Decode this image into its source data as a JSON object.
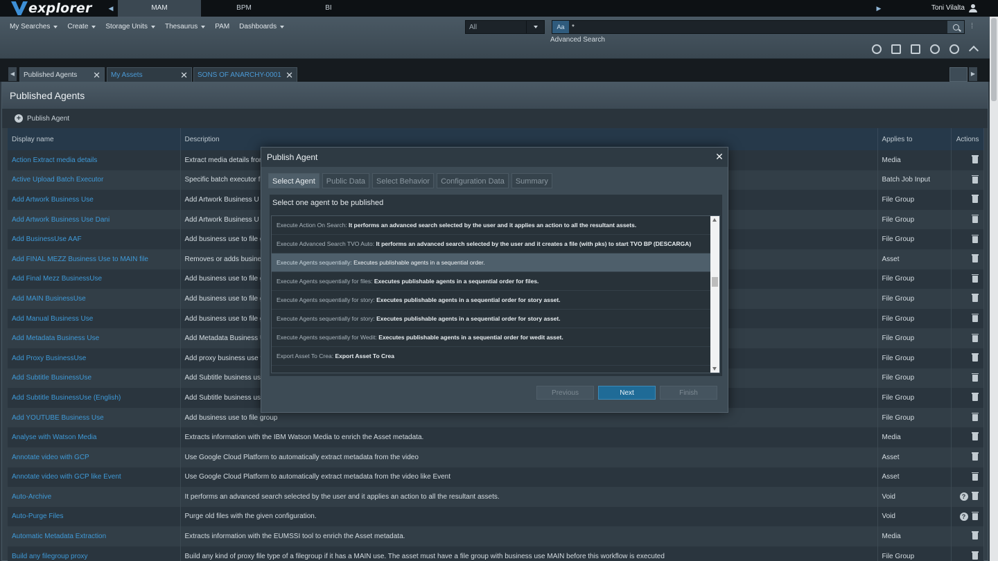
{
  "app": {
    "name": "explorer",
    "user": "Toni Vilalta"
  },
  "app_tabs": [
    {
      "label": "MAM",
      "active": true
    },
    {
      "label": "BPM",
      "active": false
    },
    {
      "label": "BI",
      "active": false
    }
  ],
  "menu": [
    "My Searches",
    "Create",
    "Storage Units",
    "Thesaurus",
    "PAM",
    "Dashboards"
  ],
  "search": {
    "scope": "All",
    "mode": "Aa",
    "query": "*",
    "advanced_label": "Advanced Search"
  },
  "doc_tabs": [
    "Published Agents",
    "My Assets",
    "SONS OF ANARCHY-0001"
  ],
  "panel": {
    "title": "Published Agents",
    "publish_label": "Publish Agent",
    "columns": {
      "name": "Display name",
      "description": "Description",
      "applies": "Applies to",
      "actions": "Actions"
    }
  },
  "rows": [
    {
      "name": "Action Extract media details",
      "desc": "Extract media details fror",
      "applies": "Media"
    },
    {
      "name": "Active Upload Batch Executor",
      "desc": "Specific batch executor fo",
      "applies": "Batch Job Input"
    },
    {
      "name": "Add Artwork Business Use",
      "desc": "Add Artwork Business U",
      "applies": "File Group"
    },
    {
      "name": "Add Artwork Business Use Dani",
      "desc": "Add Artwork Business U",
      "applies": "File Group"
    },
    {
      "name": "Add BusinessUse AAF",
      "desc": "Add business use to file g",
      "applies": "File Group"
    },
    {
      "name": "Add FINAL MEZZ Business Use to MAIN file",
      "desc": "Removes or adds busines",
      "applies": "Asset"
    },
    {
      "name": "Add Final Mezz BusinessUse",
      "desc": "Add business use to file g",
      "applies": "File Group"
    },
    {
      "name": "Add MAIN BusinessUse",
      "desc": "Add business use to file g",
      "applies": "File Group"
    },
    {
      "name": "Add Manual Business Use",
      "desc": "Add business use to file g",
      "applies": "File Group"
    },
    {
      "name": "Add Metadata Business Use",
      "desc": "Add Metadata Business U",
      "applies": "File Group"
    },
    {
      "name": "Add Proxy BusinessUse",
      "desc": "Add proxy business use t",
      "applies": "File Group"
    },
    {
      "name": "Add Subtitle BusinessUse",
      "desc": "Add Subtitle business use",
      "applies": "File Group"
    },
    {
      "name": "Add Subtitle BusinessUse (English)",
      "desc": "Add Subtitle business use",
      "applies": "File Group"
    },
    {
      "name": "Add YOUTUBE Business Use",
      "desc": "Add business use to file group",
      "applies": "File Group"
    },
    {
      "name": "Analyse with Watson Media",
      "desc": "Extracts information with the IBM Watson Media to enrich the Asset metadata.",
      "applies": "Media"
    },
    {
      "name": "Annotate video with GCP",
      "desc": "Use Google Cloud Platform to automatically extract metadata from the video",
      "applies": "Asset"
    },
    {
      "name": "Annotate video with GCP like Event",
      "desc": "Use Google Cloud Platform to automatically extract metadata from the video like Event",
      "applies": "Asset"
    },
    {
      "name": "Auto-Archive",
      "desc": "It performs an advanced search selected by the user and it applies an action to all the resultant assets.",
      "applies": "Void",
      "info": true
    },
    {
      "name": "Auto-Purge Files",
      "desc": "Purge old files with the given configuration.",
      "applies": "Void",
      "info": true
    },
    {
      "name": "Automatic Metadata Extraction",
      "desc": "Extracts information with the EUMSSI tool to enrich the Asset metadata.",
      "applies": "Media"
    },
    {
      "name": "Build any filegroup proxy",
      "desc": "Build any kind of proxy file type of a filegroup if it has a MAIN use. The asset must have a file group with business use MAIN before this workflow is executed",
      "applies": "File Group"
    }
  ],
  "modal": {
    "title": "Publish Agent",
    "steps": [
      "Select Agent",
      "Public Data",
      "Select Behavior",
      "Configuration Data",
      "Summary"
    ],
    "prompt": "Select one agent to be published",
    "agents": [
      {
        "name": "Execute Action On Search:",
        "desc": "It performs an advanced search selected by the user and it applies an action to all the resultant assets."
      },
      {
        "name": "Execute Advanced Search TVO Auto:",
        "desc": "It performs an advanced search selected by the user and it creates a file (with pks) to start TVO BP (DESCARGA)"
      },
      {
        "name": "Execute Agents sequentially:",
        "desc": "Executes publishable agents in a sequential order.",
        "selected": true
      },
      {
        "name": "Execute Agents sequentially for files:",
        "desc": "Executes publishable agents in a sequential order for files."
      },
      {
        "name": "Execute Agents sequentially for story:",
        "desc": "Executes publishable agents in a sequential order for story asset."
      },
      {
        "name": "Execute Agents sequentially for story:",
        "desc": "Executes publishable agents in a sequential order for story asset."
      },
      {
        "name": "Execute Agents sequentially for Wedit:",
        "desc": "Executes publishable agents in a sequential order for wedit asset."
      },
      {
        "name": "Export Asset To Crea:",
        "desc": "Export Asset To Crea"
      }
    ],
    "buttons": {
      "previous": "Previous",
      "next": "Next",
      "finish": "Finish"
    }
  }
}
